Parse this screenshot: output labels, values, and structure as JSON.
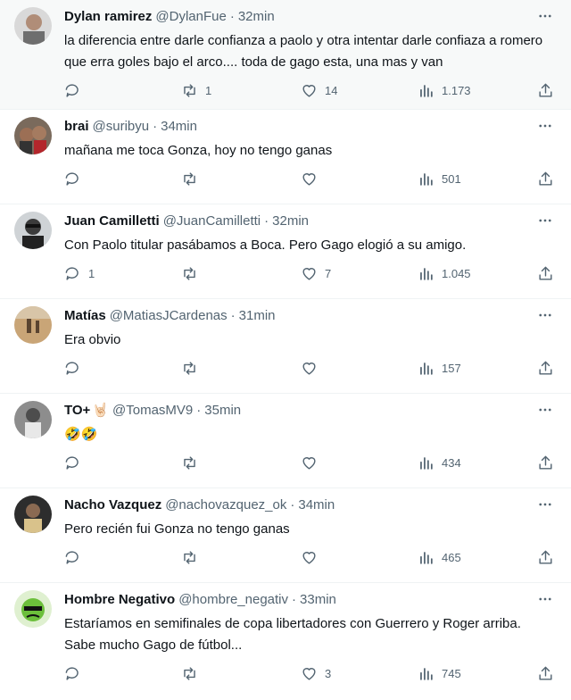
{
  "colors": {
    "text": "#0f1419",
    "muted": "#536471",
    "divider": "#eff3f4",
    "hover_bg": "#f7f9f9"
  },
  "tweets": [
    {
      "name": "Dylan ramirez",
      "handle": "@DylanFue",
      "time": "32min",
      "emoji": "",
      "text": "la diferencia entre darle confianza a paolo y otra intentar darle confiaza a romero que erra goles bajo el arco.... toda de gago esta, una mas y van",
      "replies": "",
      "retweets": "1",
      "likes": "14",
      "views": "1.173"
    },
    {
      "name": "brai",
      "handle": "@suribyu",
      "time": "34min",
      "emoji": "",
      "text": "mañana me toca Gonza, hoy no tengo ganas",
      "replies": "",
      "retweets": "",
      "likes": "",
      "views": "501"
    },
    {
      "name": "Juan Camilletti",
      "handle": "@JuanCamilletti",
      "time": "32min",
      "emoji": "",
      "text": "Con Paolo titular pasábamos a Boca. Pero Gago elogió a su amigo.",
      "replies": "1",
      "retweets": "",
      "likes": "7",
      "views": "1.045"
    },
    {
      "name": "Matías",
      "handle": "@MatiasJCardenas",
      "time": "31min",
      "emoji": "",
      "text": "Era obvio",
      "replies": "",
      "retweets": "",
      "likes": "",
      "views": "157"
    },
    {
      "name": "TO+",
      "handle": "@TomasMV9",
      "time": "35min",
      "emoji": "🤘🏻",
      "text": "🤣🤣",
      "replies": "",
      "retweets": "",
      "likes": "",
      "views": "434"
    },
    {
      "name": "Nacho Vazquez",
      "handle": "@nachovazquez_ok",
      "time": "34min",
      "emoji": "",
      "text": "Pero recién fui Gonza no tengo ganas",
      "replies": "",
      "retweets": "",
      "likes": "",
      "views": "465"
    },
    {
      "name": "Hombre Negativo",
      "handle": "@hombre_negativ",
      "time": "33min",
      "emoji": "",
      "text": "Estaríamos en semifinales de copa libertadores con Guerrero y Roger arriba. Sabe mucho Gago de fútbol...",
      "replies": "",
      "retweets": "",
      "likes": "3",
      "views": "745"
    }
  ],
  "sep": "·"
}
